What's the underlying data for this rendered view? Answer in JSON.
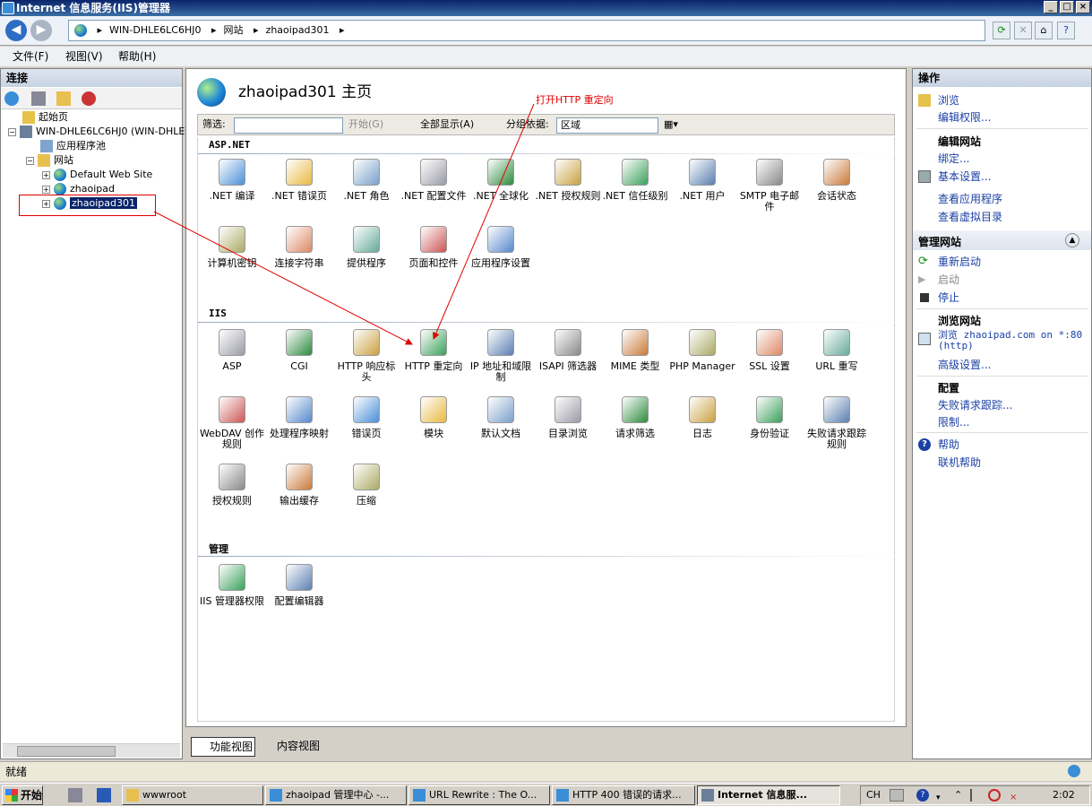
{
  "window": {
    "title": "Internet 信息服务(IIS)管理器",
    "buttons": [
      "_",
      "□",
      "×"
    ]
  },
  "address": {
    "parts": [
      "WIN-DHLE6LC6HJ0",
      "网站",
      "zhaoipad301"
    ]
  },
  "menu": [
    "文件(F)",
    "视图(V)",
    "帮助(H)"
  ],
  "connections": {
    "header": "连接",
    "tree": [
      {
        "label": "起始页",
        "indent": 0
      },
      {
        "label": "WIN-DHLE6LC6HJ0 (WIN-DHLE6",
        "indent": 0
      },
      {
        "label": "应用程序池",
        "indent": 1
      },
      {
        "label": "网站",
        "indent": 1
      },
      {
        "label": "Default Web Site",
        "indent": 2
      },
      {
        "label": "zhaoipad",
        "indent": 2
      },
      {
        "label": "zhaoipad301",
        "indent": 2,
        "selected": true
      }
    ]
  },
  "center": {
    "title": "zhaoipad301 主页",
    "filter": {
      "label": "筛选:",
      "go": "开始(G)",
      "show_all": "全部显示(A)",
      "group_label": "分组依据:",
      "group_value": "区域"
    },
    "sections": [
      {
        "name": "ASP.NET",
        "items": [
          ".NET 编译",
          ".NET 错误页",
          ".NET 角色",
          ".NET 配置文件",
          ".NET 全球化",
          ".NET 授权规则",
          ".NET 信任级别",
          ".NET 用户",
          "SMTP 电子邮件",
          "会话状态",
          "计算机密钥",
          "连接字符串",
          "提供程序",
          "页面和控件",
          "应用程序设置"
        ]
      },
      {
        "name": "IIS",
        "items": [
          "ASP",
          "CGI",
          "HTTP 响应标头",
          "HTTP 重定向",
          "IP 地址和域限制",
          "ISAPI 筛选器",
          "MIME 类型",
          "PHP Manager",
          "SSL 设置",
          "URL 重写",
          "WebDAV 创作规则",
          "处理程序映射",
          "错误页",
          "模块",
          "默认文档",
          "目录浏览",
          "请求筛选",
          "日志",
          "身份验证",
          "失败请求跟踪规则",
          "授权规则",
          "输出缓存",
          "压缩"
        ]
      },
      {
        "name": "管理",
        "items": [
          "IIS 管理器权限",
          "配置编辑器"
        ]
      }
    ],
    "tabs": [
      "功能视图",
      "内容视图"
    ]
  },
  "annotation": "打开HTTP 重定向",
  "actions": {
    "header": "操作",
    "browse": "浏览",
    "edit_perms": "编辑权限...",
    "edit_site": "编辑网站",
    "bindings": "绑定...",
    "basic_settings": "基本设置...",
    "view_apps": "查看应用程序",
    "view_vdirs": "查看虚拟目录",
    "manage_site": "管理网站",
    "restart": "重新启动",
    "start": "启动",
    "stop": "停止",
    "browse_site": "浏览网站",
    "browse_link": "浏览 zhaoipad.com on *:80",
    "browse_link2": "(http)",
    "advanced": "高级设置...",
    "config": "配置",
    "failed_trace": "失败请求跟踪...",
    "limits": "限制...",
    "help": "帮助",
    "online_help": "联机帮助"
  },
  "status": "就绪",
  "taskbar": {
    "start": "开始",
    "tasks": [
      "wwwroot",
      "zhaoipad 管理中心 -...",
      "URL Rewrite : The O...",
      "HTTP 400 错误的请求...",
      "Internet 信息服..."
    ],
    "tray_lang": "CH",
    "clock": "2:02"
  }
}
